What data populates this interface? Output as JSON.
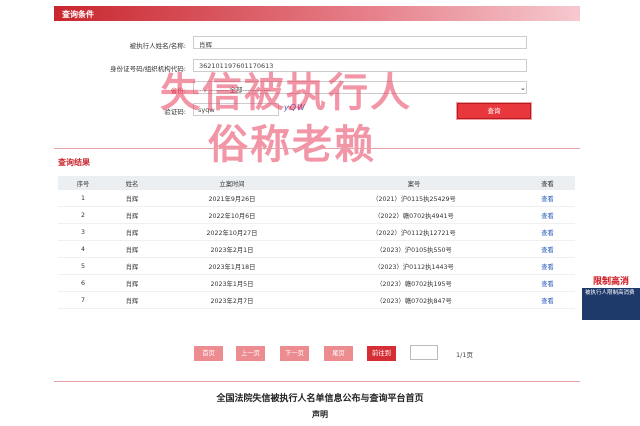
{
  "panel": {
    "title": "查询条件"
  },
  "form": {
    "name_label": "被执行人姓名/名称:",
    "name_value": "肖辉",
    "id_label": "身份证号码/组织机构代码:",
    "id_value": "362101197601170613",
    "province_label": "省份:",
    "province_value": "-------------全部------------",
    "captcha_label": "验证码:",
    "captcha_value": "syqw",
    "captcha_image_text": "yQW",
    "query_button": "查询"
  },
  "watermark": {
    "line1": "失信被执行人",
    "line2": "俗称老赖"
  },
  "results": {
    "title": "查询结果",
    "headers": [
      "序号",
      "姓名",
      "立案时间",
      "案号",
      "查看"
    ],
    "rows": [
      {
        "no": "1",
        "name": "肖辉",
        "date": "2021年9月26日",
        "case": "（2021）沪0115执25429号",
        "view": "查看"
      },
      {
        "no": "2",
        "name": "肖辉",
        "date": "2022年10月6日",
        "case": "（2022）赣0702执4941号",
        "view": "查看"
      },
      {
        "no": "3",
        "name": "肖辉",
        "date": "2022年10月27日",
        "case": "（2022）沪0112执12721号",
        "view": "查看"
      },
      {
        "no": "4",
        "name": "肖辉",
        "date": "2023年2月1日",
        "case": "（2023）沪0105执550号",
        "view": "查看"
      },
      {
        "no": "5",
        "name": "肖辉",
        "date": "2023年1月18日",
        "case": "（2023）沪0112执1443号",
        "view": "查看"
      },
      {
        "no": "6",
        "name": "肖辉",
        "date": "2023年1月5日",
        "case": "（2023）赣0702执195号",
        "view": "查看"
      },
      {
        "no": "7",
        "name": "肖辉",
        "date": "2023年2月7日",
        "case": "（2023）赣0702执847号",
        "view": "查看"
      }
    ]
  },
  "pager": {
    "first": "首页",
    "prev": "上一页",
    "next": "下一页",
    "last": "尾页",
    "goto": "前往到",
    "info": "1/1页"
  },
  "footer": {
    "title": "全国法院失信被执行人名单信息公布与查询平台首页",
    "subtitle": "声明"
  },
  "ad": {
    "title": "限制高消",
    "text": "被执行人限制高消费"
  }
}
